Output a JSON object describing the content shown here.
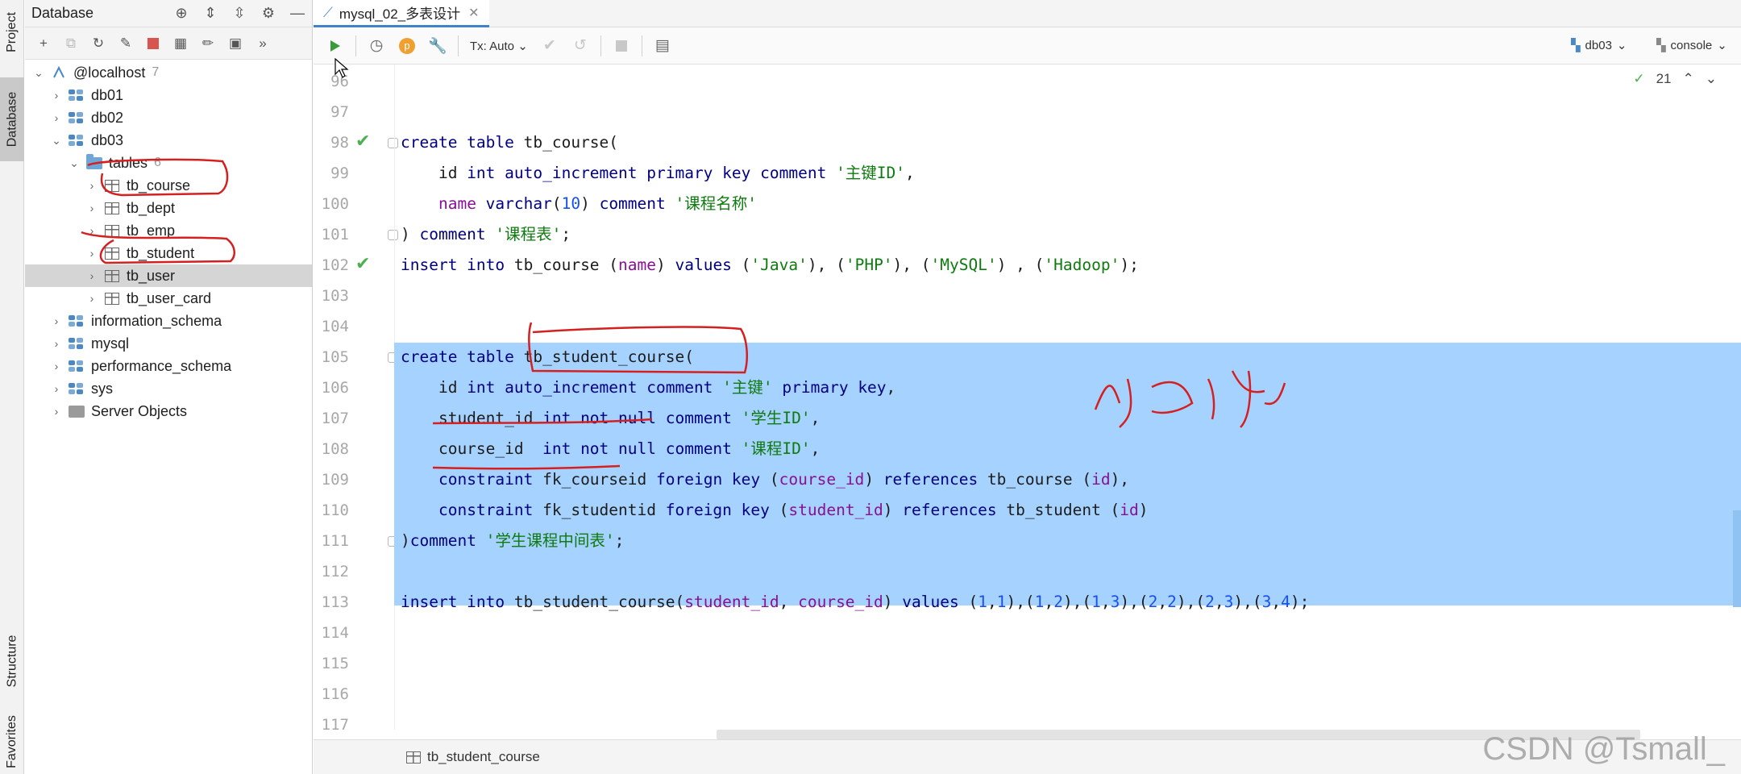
{
  "left_strip": {
    "project_tab": "Project",
    "database_tab": "Database",
    "structure_tab": "Structure",
    "favorites_tab": "Favorites"
  },
  "db_panel": {
    "title": "Database"
  },
  "tree": {
    "root": {
      "label": "@localhost",
      "count": "7"
    },
    "items": [
      {
        "label": "db01"
      },
      {
        "label": "db02"
      },
      {
        "label": "db03"
      },
      {
        "label": "tables",
        "count": "6"
      },
      {
        "label": "tb_course"
      },
      {
        "label": "tb_dept"
      },
      {
        "label": "tb_emp"
      },
      {
        "label": "tb_student"
      },
      {
        "label": "tb_user"
      },
      {
        "label": "tb_user_card"
      },
      {
        "label": "information_schema"
      },
      {
        "label": "mysql"
      },
      {
        "label": "performance_schema"
      },
      {
        "label": "sys"
      },
      {
        "label": "Server Objects"
      }
    ]
  },
  "editor": {
    "tab_title": "mysql_02_多表设计",
    "tx_mode": "Tx: Auto",
    "schema_selector": "db03",
    "console_selector": "console",
    "inspection_count": "21",
    "status_breadcrumb": "tb_student_course",
    "line_numbers": [
      "96",
      "97",
      "98",
      "99",
      "100",
      "101",
      "102",
      "103",
      "104",
      "105",
      "106",
      "107",
      "108",
      "109",
      "110",
      "111",
      "112",
      "113",
      "114",
      "115",
      "116",
      "117"
    ],
    "code": {
      "l98": [
        [
          "k",
          "create table "
        ],
        [
          "t",
          "tb_course("
        ]
      ],
      "l99": [
        [
          "t",
          "    id "
        ],
        [
          "k",
          "int auto_increment primary key comment "
        ],
        [
          "s",
          "'主键ID'"
        ],
        [
          "t",
          ","
        ]
      ],
      "l100": [
        [
          "t",
          "    "
        ],
        [
          "p",
          "name "
        ],
        [
          "k",
          "varchar"
        ],
        [
          "t",
          "("
        ],
        [
          "n",
          "10"
        ],
        [
          "t",
          ") "
        ],
        [
          "k",
          "comment "
        ],
        [
          "s",
          "'课程名称'"
        ]
      ],
      "l101": [
        [
          "t",
          ") "
        ],
        [
          "k",
          "comment "
        ],
        [
          "s",
          "'课程表'"
        ],
        [
          "t",
          ";"
        ]
      ],
      "l102": [
        [
          "k",
          "insert into "
        ],
        [
          "t",
          "tb_course ("
        ],
        [
          "p",
          "name"
        ],
        [
          "t",
          ") "
        ],
        [
          "k",
          "values "
        ],
        [
          "t",
          "("
        ],
        [
          "s",
          "'Java'"
        ],
        [
          "t",
          "), ("
        ],
        [
          "s",
          "'PHP'"
        ],
        [
          "t",
          "), ("
        ],
        [
          "s",
          "'MySQL'"
        ],
        [
          "t",
          ") , ("
        ],
        [
          "s",
          "'Hadoop'"
        ],
        [
          "t",
          ");"
        ]
      ],
      "l105": [
        [
          "k",
          "create table "
        ],
        [
          "t",
          "tb_student_course("
        ]
      ],
      "l106": [
        [
          "t",
          "    id "
        ],
        [
          "k",
          "int auto_increment comment "
        ],
        [
          "s",
          "'主键'"
        ],
        [
          "k",
          " primary key"
        ],
        [
          "t",
          ","
        ]
      ],
      "l107": [
        [
          "t",
          "    student_id "
        ],
        [
          "k",
          "int not null comment "
        ],
        [
          "s",
          "'学生ID'"
        ],
        [
          "t",
          ","
        ]
      ],
      "l108": [
        [
          "t",
          "    course_id  "
        ],
        [
          "k",
          "int not null comment "
        ],
        [
          "s",
          "'课程ID'"
        ],
        [
          "t",
          ","
        ]
      ],
      "l109": [
        [
          "t",
          "    "
        ],
        [
          "k",
          "constraint "
        ],
        [
          "t",
          "fk_courseid "
        ],
        [
          "k",
          "foreign key "
        ],
        [
          "t",
          "("
        ],
        [
          "p",
          "course_id"
        ],
        [
          "t",
          ") "
        ],
        [
          "k",
          "references "
        ],
        [
          "t",
          "tb_course ("
        ],
        [
          "p",
          "id"
        ],
        [
          "t",
          "),"
        ]
      ],
      "l110": [
        [
          "t",
          "    "
        ],
        [
          "k",
          "constraint "
        ],
        [
          "t",
          "fk_studentid "
        ],
        [
          "k",
          "foreign key "
        ],
        [
          "t",
          "("
        ],
        [
          "p",
          "student_id"
        ],
        [
          "t",
          ") "
        ],
        [
          "k",
          "references "
        ],
        [
          "t",
          "tb_student ("
        ],
        [
          "p",
          "id"
        ],
        [
          "t",
          ")"
        ]
      ],
      "l111": [
        [
          "t",
          ")"
        ],
        [
          "k",
          "comment "
        ],
        [
          "s",
          "'学生课程中间表'"
        ],
        [
          "t",
          ";"
        ]
      ],
      "l113": [
        [
          "k",
          "insert into "
        ],
        [
          "t",
          "tb_student_course("
        ],
        [
          "p",
          "student_id"
        ],
        [
          "t",
          ", "
        ],
        [
          "p",
          "course_id"
        ],
        [
          "t",
          ") "
        ],
        [
          "k",
          "values "
        ],
        [
          "t",
          "("
        ],
        [
          "n",
          "1"
        ],
        [
          "t",
          ","
        ],
        [
          "n",
          "1"
        ],
        [
          "t",
          "),("
        ],
        [
          "n",
          "1"
        ],
        [
          "t",
          ","
        ],
        [
          "n",
          "2"
        ],
        [
          "t",
          "),("
        ],
        [
          "n",
          "1"
        ],
        [
          "t",
          ","
        ],
        [
          "n",
          "3"
        ],
        [
          "t",
          "),("
        ],
        [
          "n",
          "2"
        ],
        [
          "t",
          ","
        ],
        [
          "n",
          "2"
        ],
        [
          "t",
          "),("
        ],
        [
          "n",
          "2"
        ],
        [
          "t",
          ","
        ],
        [
          "n",
          "3"
        ],
        [
          "t",
          "),("
        ],
        [
          "n",
          "3"
        ],
        [
          "t",
          ","
        ],
        [
          "n",
          "4"
        ],
        [
          "t",
          ");"
        ]
      ]
    }
  },
  "watermark": "CSDN @Tsmall_",
  "colors": {
    "selection": "#a6d2ff",
    "keyword": "#000080",
    "string": "#0f7a0f",
    "number": "#1750eb",
    "field": "#871094",
    "annotation": "#d42020",
    "run": "#4caf50"
  }
}
